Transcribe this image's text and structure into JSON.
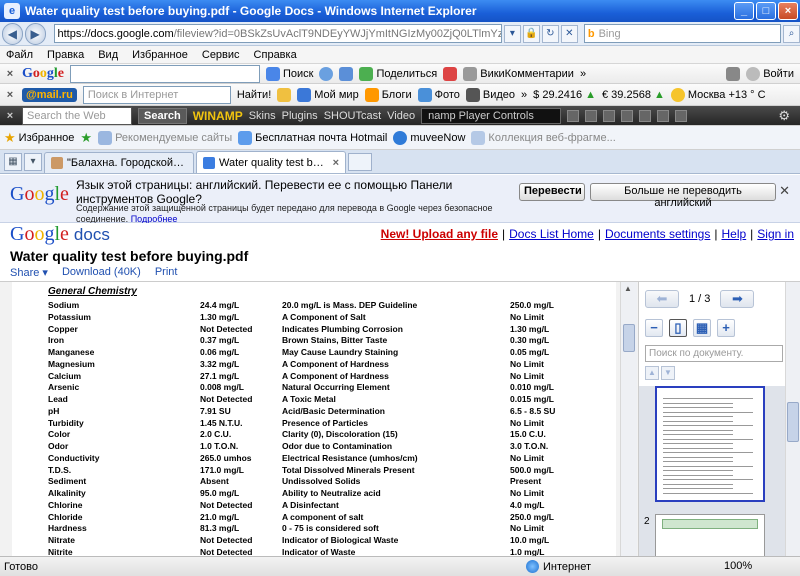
{
  "window": {
    "title": "Water quality test before buying.pdf - Google Docs - Windows Internet Explorer"
  },
  "address": {
    "url_host": "https://docs.google.com",
    "url_rest": "/fileview?id=0BSkZsUvAclT9NDEyYWJjYmItNGIzMy00ZjQ0LTlmYzYtYmZmNzM1Nm",
    "search_placeholder": "Bing"
  },
  "menu": [
    "Файл",
    "Правка",
    "Вид",
    "Избранное",
    "Сервис",
    "Справка"
  ],
  "google_toolbar": {
    "logo": "Google",
    "search": "Поиск",
    "share": "Поделиться",
    "wiki": "ВикиКомментарии",
    "more": "»",
    "login": "Войти"
  },
  "mail_toolbar": {
    "logo_left": "@mail",
    "logo_right": ".ru",
    "search_placeholder": "Поиск в Интернет",
    "find": "Найти!",
    "items": [
      "Мой мир",
      "Блоги",
      "Фото",
      "Видео",
      "»"
    ],
    "usd": "$ 29.2416",
    "eur": "€ 39.2568",
    "weather": "Москва +13 ° C"
  },
  "winamp_toolbar": {
    "search_placeholder": "Search the Web",
    "search_button": "Search",
    "logo": "WINAMP",
    "menus": [
      "Skins",
      "Plugins",
      "SHOUTcast",
      "Video"
    ],
    "player": "namp Player Controls"
  },
  "favorites_bar": {
    "label": "Избранное",
    "items": [
      "Рекомендуемые сайты",
      "Бесплатная почта Hotmail",
      "muveeNow",
      "Коллекция веб-фрагме..."
    ]
  },
  "tabs": [
    {
      "label": "\"Балахна. Городской порта...",
      "active": false
    },
    {
      "label": "Water quality test before ...",
      "active": true
    }
  ],
  "translate_bar": {
    "logo": "Google",
    "message": "Язык этой страницы: английский. Перевести ее с помощью Панели инструментов Google?",
    "secure_note": "Содержание этой защищенной страницы будет передано для перевода в Google через безопасное соединение.",
    "details": "Подробнее",
    "translate_button": "Перевести",
    "never_button": "Больше не переводить английский"
  },
  "docs": {
    "logo_google": "Google",
    "logo_docs": "docs",
    "links": [
      "New! Upload any file",
      "Docs List Home",
      "Documents settings",
      "Help",
      "Sign in"
    ],
    "title": "Water quality test before buying.pdf",
    "actions": [
      "Share ▾",
      "Download (40K)",
      "Print"
    ]
  },
  "document": {
    "section": "General Chemistry",
    "rows": [
      {
        "name": "Sodium",
        "result": "24.4  mg/L",
        "desc": "20.0 mg/L is Mass. DEP Guideline",
        "limit": "250.0 mg/L"
      },
      {
        "name": "Potassium",
        "result": "1.30  mg/L",
        "desc": "A Component of Salt",
        "limit": "No Limit"
      },
      {
        "name": "Copper",
        "result": "Not Detected",
        "desc": "Indicates Plumbing Corrosion",
        "limit": "1.30 mg/L"
      },
      {
        "name": "Iron",
        "result": "0.37  mg/L",
        "desc": "Brown Stains, Bitter Taste",
        "limit": "0.30 mg/L"
      },
      {
        "name": "Manganese",
        "result": "0.06  mg/L",
        "desc": "May Cause Laundry Staining",
        "limit": "0.05 mg/L"
      },
      {
        "name": "Magnesium",
        "result": "3.32  mg/L",
        "desc": "A Component of Hardness",
        "limit": "No Limit"
      },
      {
        "name": "Calcium",
        "result": "27.1  mg/L",
        "desc": "A Component of Hardness",
        "limit": "No Limit"
      },
      {
        "name": "Arsenic",
        "result": "0.008  mg/L",
        "desc": "Natural Occurring Element",
        "limit": "0.010 mg/L"
      },
      {
        "name": "Lead",
        "result": "Not Detected",
        "desc": "A Toxic Metal",
        "limit": "0.015 mg/L"
      },
      {
        "name": "pH",
        "result": "7.91  SU",
        "desc": "Acid/Basic Determination",
        "limit": "6.5 - 8.5 SU"
      },
      {
        "name": "Turbidity",
        "result": "1.45  N.T.U.",
        "desc": "Presence of Particles",
        "limit": "No Limit"
      },
      {
        "name": "Color",
        "result": "2.0  C.U.",
        "desc": "Clarity (0), Discoloration (15)",
        "limit": "15.0 C.U."
      },
      {
        "name": "Odor",
        "result": "1.0  T.O.N.",
        "desc": "Odor due to Contamination",
        "limit": "3.0 T.O.N."
      },
      {
        "name": "Conductivity",
        "result": "265.0  umhos",
        "desc": "Electrical Resistance (umhos/cm)",
        "limit": "No Limit"
      },
      {
        "name": "T.D.S.",
        "result": "171.0  mg/L",
        "desc": "Total Dissolved Minerals Present",
        "limit": "500.0 mg/L"
      },
      {
        "name": "Sediment",
        "result": "Absent",
        "desc": "Undissolved Solids",
        "limit": "Present"
      },
      {
        "name": "Alkalinity",
        "result": "95.0  mg/L",
        "desc": "Ability to Neutralize acid",
        "limit": "No Limit"
      },
      {
        "name": "Chlorine",
        "result": "Not Detected",
        "desc": "A Disinfectant",
        "limit": "4.0 mg/L"
      },
      {
        "name": "Chloride",
        "result": "21.0  mg/L",
        "desc": "A component of salt",
        "limit": "250.0 mg/L"
      },
      {
        "name": "Hardness",
        "result": "81.3  mg/L",
        "desc": "0 - 75 is considered soft",
        "limit": "No Limit"
      },
      {
        "name": "Nitrate",
        "result": "Not Detected",
        "desc": "Indicator of Biological Waste",
        "limit": "10.0 mg/L"
      },
      {
        "name": "Nitrite",
        "result": "Not Detected",
        "desc": "Indicator of Waste",
        "limit": "1.0 mg/L"
      }
    ]
  },
  "viewer": {
    "page_indicator": "1 / 3",
    "search_placeholder": "Поиск по документу.",
    "page2_label": "2"
  },
  "status": {
    "text": "Готово",
    "zone": "Интернет",
    "zoom": "100%"
  }
}
